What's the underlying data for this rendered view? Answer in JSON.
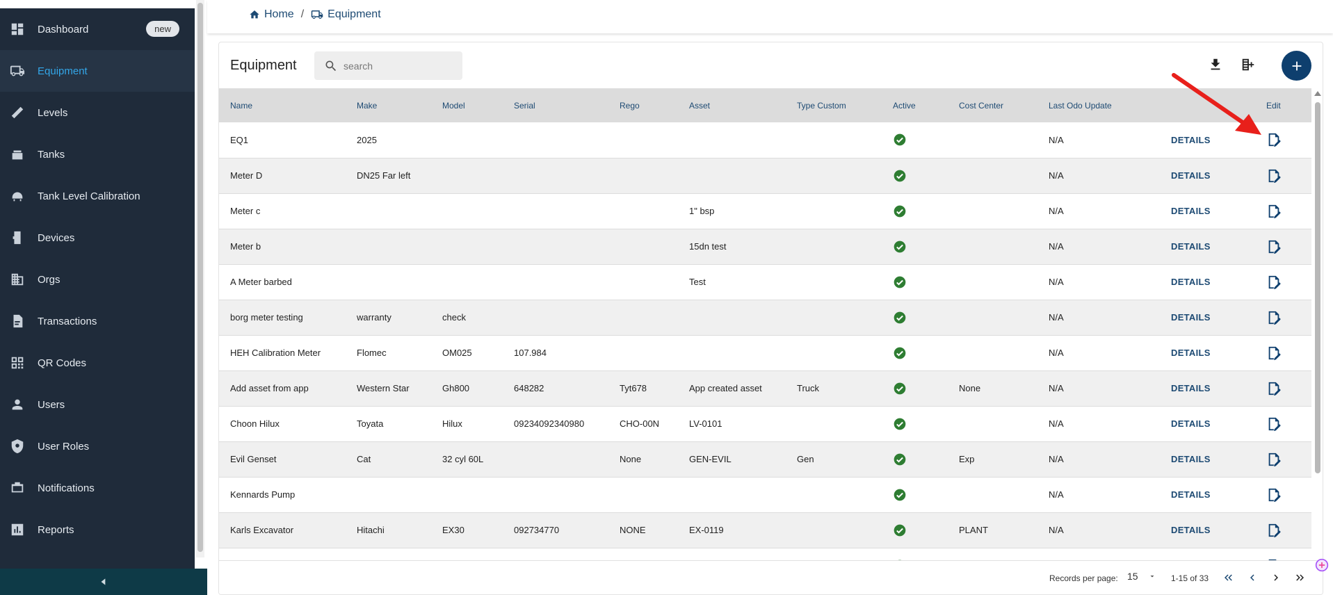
{
  "sidebar": {
    "items": [
      {
        "label": "Dashboard",
        "icon": "dashboard-icon",
        "badge": "new"
      },
      {
        "label": "Equipment",
        "icon": "truck-icon",
        "active": true
      },
      {
        "label": "Levels",
        "icon": "ruler-icon"
      },
      {
        "label": "Tanks",
        "icon": "tank-icon"
      },
      {
        "label": "Tank Level Calibration",
        "icon": "calibration-icon"
      },
      {
        "label": "Devices",
        "icon": "device-icon"
      },
      {
        "label": "Orgs",
        "icon": "building-icon"
      },
      {
        "label": "Transactions",
        "icon": "receipt-icon"
      },
      {
        "label": "QR Codes",
        "icon": "qr-code-icon"
      },
      {
        "label": "Users",
        "icon": "user-icon"
      },
      {
        "label": "User Roles",
        "icon": "shield-icon"
      },
      {
        "label": "Notifications",
        "icon": "notification-icon"
      },
      {
        "label": "Reports",
        "icon": "chart-icon"
      }
    ]
  },
  "breadcrumb": {
    "home": "Home",
    "separator": "/",
    "current": "Equipment"
  },
  "card": {
    "title": "Equipment",
    "search_placeholder": "search"
  },
  "table": {
    "headers": [
      "Name",
      "Make",
      "Model",
      "Serial",
      "Rego",
      "Asset",
      "Type Custom",
      "Active",
      "Cost Center",
      "Last Odo Update",
      "",
      "Edit"
    ],
    "details_label": "DETAILS",
    "rows": [
      {
        "name": "EQ1",
        "make": "2025",
        "model": "",
        "serial": "",
        "rego": "",
        "asset": "",
        "type_custom": "",
        "active": true,
        "cost_center": "",
        "last_odo": "N/A"
      },
      {
        "name": "Meter D",
        "make": "DN25 Far left",
        "model": "",
        "serial": "",
        "rego": "",
        "asset": "",
        "type_custom": "",
        "active": true,
        "cost_center": "",
        "last_odo": "N/A"
      },
      {
        "name": "Meter c",
        "make": "",
        "model": "",
        "serial": "",
        "rego": "",
        "asset": "1\" bsp",
        "type_custom": "",
        "active": true,
        "cost_center": "",
        "last_odo": "N/A"
      },
      {
        "name": "Meter b",
        "make": "",
        "model": "",
        "serial": "",
        "rego": "",
        "asset": "15dn test",
        "type_custom": "",
        "active": true,
        "cost_center": "",
        "last_odo": "N/A"
      },
      {
        "name": "A Meter barbed",
        "make": "",
        "model": "",
        "serial": "",
        "rego": "",
        "asset": "Test",
        "type_custom": "",
        "active": true,
        "cost_center": "",
        "last_odo": "N/A"
      },
      {
        "name": "borg meter testing",
        "make": "warranty",
        "model": "check",
        "serial": "",
        "rego": "",
        "asset": "",
        "type_custom": "",
        "active": true,
        "cost_center": "",
        "last_odo": "N/A"
      },
      {
        "name": "HEH Calibration Meter",
        "make": "Flomec",
        "model": "OM025",
        "serial": "107.984",
        "rego": "",
        "asset": "",
        "type_custom": "",
        "active": true,
        "cost_center": "",
        "last_odo": "N/A"
      },
      {
        "name": "Add asset from app",
        "make": "Western Star",
        "model": "Gh800",
        "serial": "648282",
        "rego": "Tyt678",
        "asset": "App created asset",
        "type_custom": "Truck",
        "active": true,
        "cost_center": "None",
        "last_odo": "N/A"
      },
      {
        "name": "Choon Hilux",
        "make": "Toyata",
        "model": "Hilux",
        "serial": "09234092340980",
        "rego": "CHO-00N",
        "asset": "LV-0101",
        "type_custom": "",
        "active": true,
        "cost_center": "",
        "last_odo": "N/A"
      },
      {
        "name": "Evil Genset",
        "make": "Cat",
        "model": "32 cyl 60L",
        "serial": "",
        "rego": "None",
        "asset": "GEN-EVIL",
        "type_custom": "Gen",
        "active": true,
        "cost_center": "Exp",
        "last_odo": "N/A"
      },
      {
        "name": "Kennards Pump",
        "make": "",
        "model": "",
        "serial": "",
        "rego": "",
        "asset": "",
        "type_custom": "",
        "active": true,
        "cost_center": "",
        "last_odo": "N/A"
      },
      {
        "name": "Karls Excavator",
        "make": "Hitachi",
        "model": "EX30",
        "serial": "092734770",
        "rego": "NONE",
        "asset": "EX-0119",
        "type_custom": "",
        "active": true,
        "cost_center": "PLANT",
        "last_odo": "N/A"
      },
      {
        "name": "",
        "make": "",
        "model": "",
        "serial": "",
        "rego": "",
        "asset": "",
        "type_custom": "",
        "active": true,
        "cost_center": "",
        "last_odo": ""
      }
    ]
  },
  "footer": {
    "records_per_page_label": "Records per page:",
    "records_per_page": "15",
    "range": "1-15 of 33"
  },
  "colors": {
    "sidebar_bg": "#1f2b3a",
    "active_text": "#33a6e8",
    "primary": "#0e3f6e",
    "check_green": "#2e7d32",
    "annotation_red": "#e8201b"
  }
}
